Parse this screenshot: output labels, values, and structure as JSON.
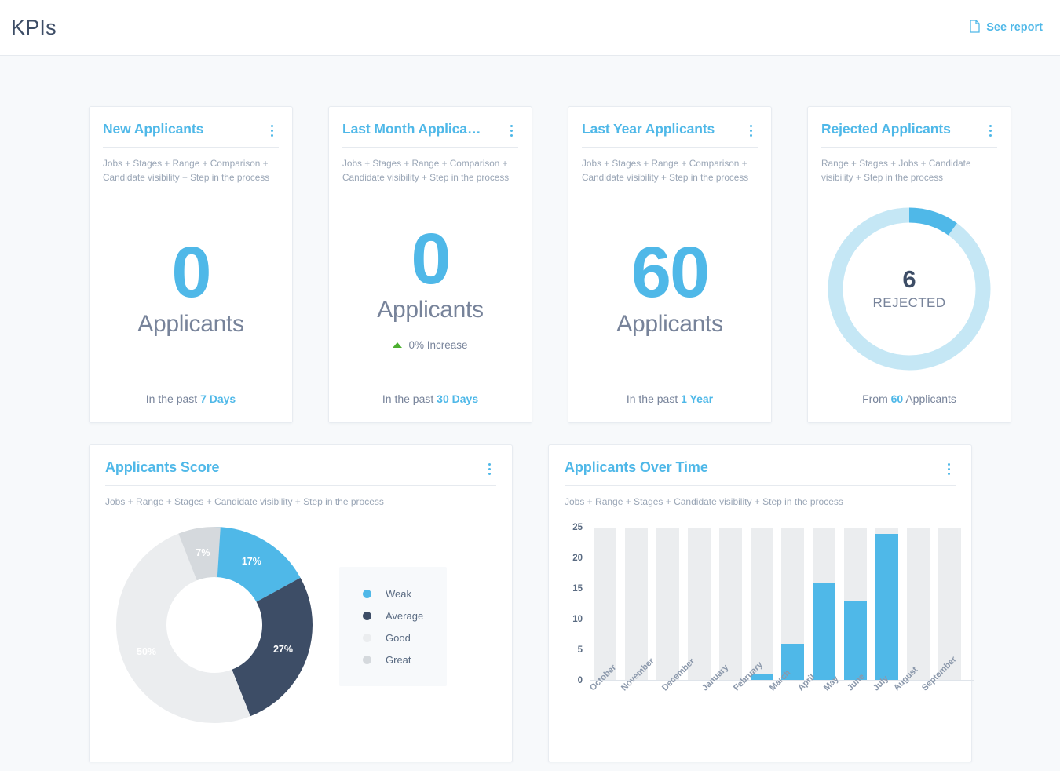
{
  "header": {
    "title": "KPIs",
    "see_report_label": "See report",
    "see_report_icon": "document-icon"
  },
  "colors": {
    "accent": "#4fb8e8",
    "accent_light": "#c5e7f5",
    "navy": "#3d4d66",
    "muted": "#77839a",
    "grey_light": "#ebedef",
    "grey_mid": "#d5d9dd",
    "green": "#4caf2f"
  },
  "kpi_cards": [
    {
      "title": "New Applicants",
      "subtitle": "Jobs + Stages + Range + Comparison + Candidate visibility + Step in the process",
      "value": "0",
      "unit": "Applicants",
      "change": null,
      "footer_prefix": "In the past",
      "footer_value": "7 Days",
      "footer_suffix": ""
    },
    {
      "title": "Last Month Applica…",
      "subtitle": "Jobs + Stages + Range + Comparison + Candidate visibility + Step in the process",
      "value": "0",
      "unit": "Applicants",
      "change": "0% Increase",
      "footer_prefix": "In the past",
      "footer_value": "30 Days",
      "footer_suffix": ""
    },
    {
      "title": "Last Year Applicants",
      "subtitle": "Jobs + Stages + Range + Comparison + Candidate visibility + Step in the process",
      "value": "60",
      "unit": "Applicants",
      "change": null,
      "footer_prefix": "In the past",
      "footer_value": "1 Year",
      "footer_suffix": ""
    }
  ],
  "rejected_card": {
    "title": "Rejected Applicants",
    "subtitle": "Range + Stages + Jobs + Candidate visibility + Step in the process",
    "center_value": "6",
    "center_label": "REJECTED",
    "footer_prefix": "From",
    "footer_value": "60",
    "footer_suffix": "Applicants"
  },
  "score_card": {
    "title": "Applicants Score",
    "subtitle": "Jobs + Range + Stages + Candidate visibility + Step in the process"
  },
  "time_card": {
    "title": "Applicants Over Time",
    "subtitle": "Jobs + Range + Stages + Candidate visibility + Step in the process"
  },
  "chart_data": [
    {
      "type": "pie",
      "title": "Rejected Applicants",
      "subtype": "donut-gauge",
      "labels": [
        "Rejected",
        "Remaining"
      ],
      "values": [
        6,
        54
      ],
      "total": 60,
      "percent": 10,
      "colors": [
        "#4fb8e8",
        "#c5e7f5"
      ],
      "center_value": "6",
      "center_label": "REJECTED",
      "legend": "none"
    },
    {
      "type": "pie",
      "title": "Applicants Score",
      "subtype": "donut",
      "labels": [
        "Weak",
        "Average",
        "Good",
        "Great"
      ],
      "values": [
        17,
        27,
        50,
        7
      ],
      "value_labels": [
        "17%",
        "27%",
        "50%",
        "7%"
      ],
      "colors": [
        "#4fb8e8",
        "#3d4d66",
        "#ebedef",
        "#d5d9dd"
      ],
      "legend": "right",
      "start_angle": 0
    },
    {
      "type": "bar",
      "title": "Applicants Over Time",
      "categories": [
        "October",
        "November",
        "December",
        "January",
        "February",
        "March",
        "April",
        "May",
        "June",
        "July",
        "August",
        "September"
      ],
      "values": [
        0,
        0,
        0,
        0,
        0,
        1,
        6,
        16,
        13,
        24,
        0,
        0
      ],
      "yticks": [
        0,
        5,
        10,
        15,
        20,
        25
      ],
      "ylim": [
        0,
        25
      ],
      "xlabel": "",
      "ylabel": "",
      "grid": false,
      "bar_color": "#4fb8e8",
      "track_color": "#ebedef",
      "legend": "none"
    }
  ]
}
